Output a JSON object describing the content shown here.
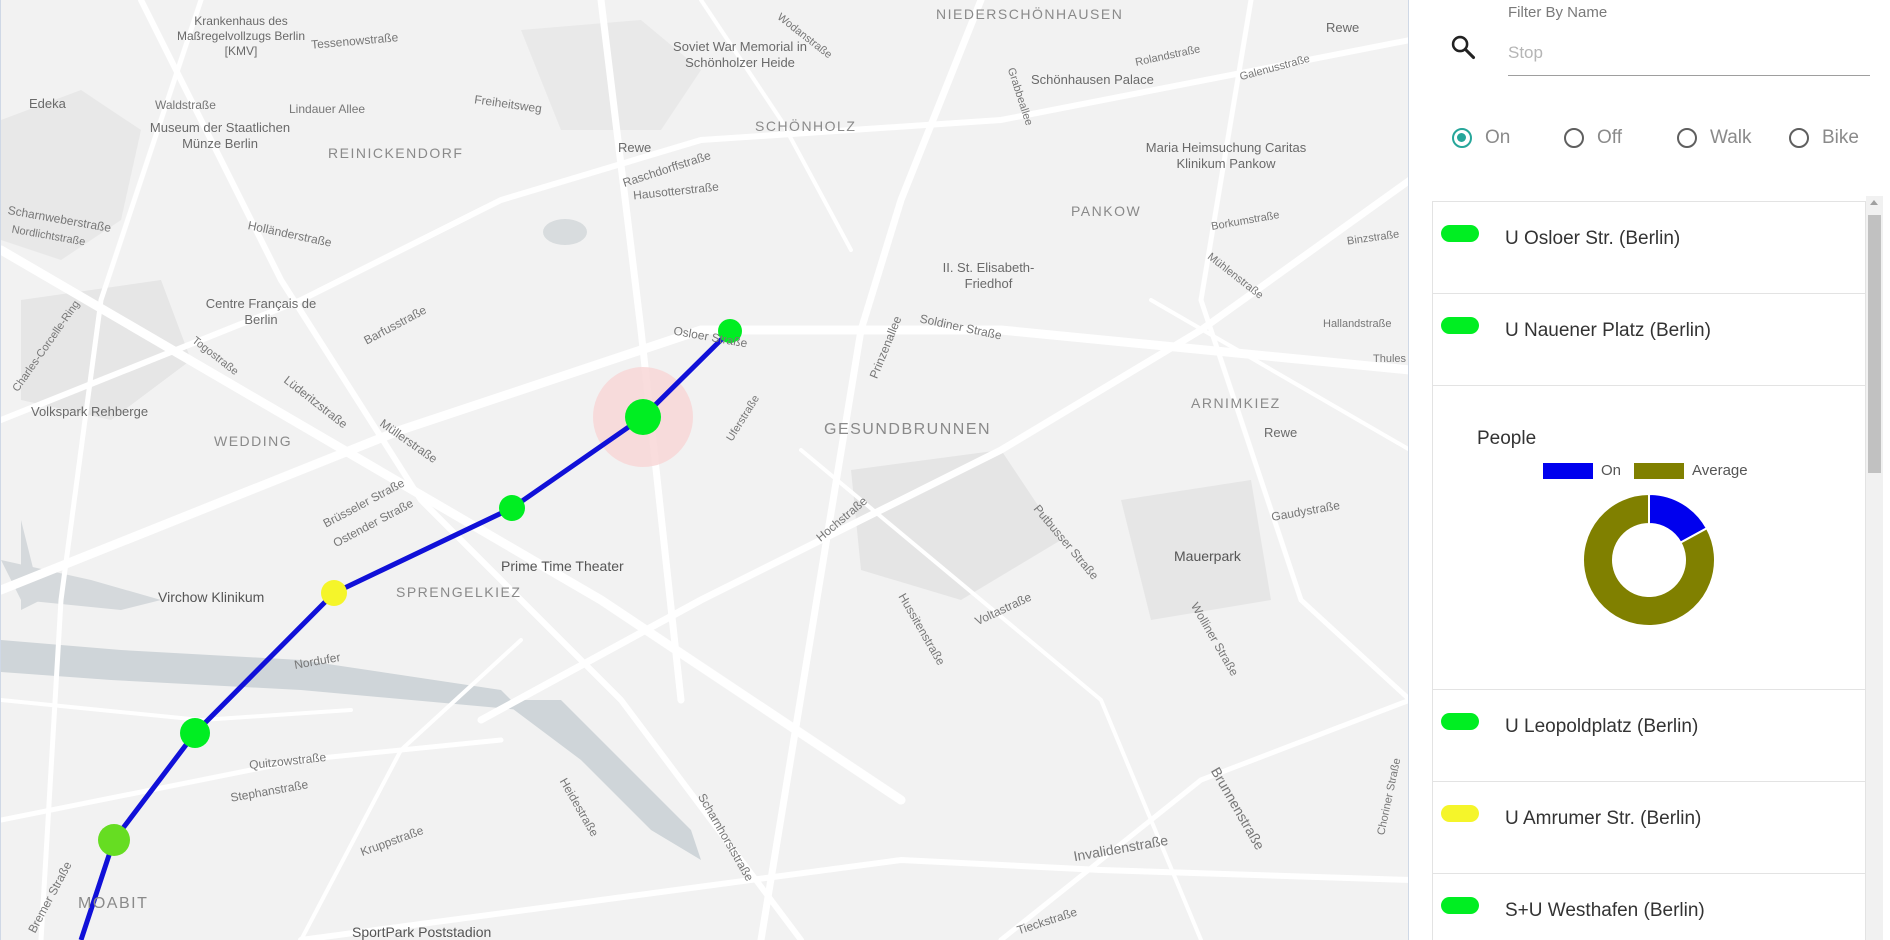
{
  "map": {
    "districts": [
      "NIEDERSCHÖNHAUSEN",
      "SCHÖNHOLZ",
      "REINICKENDORF",
      "PANKOW",
      "WEDDING",
      "GESUNDBRUNNEN",
      "ARNIMKIEZ",
      "SPRENGELKIEZ",
      "MOABIT"
    ],
    "streets": [
      "Tessenowstraße",
      "Waldstraße",
      "Lindauer Allee",
      "Freiheitsweg",
      "Scharnweberstraße",
      "Nordlichtstraße",
      "Holländerstraße",
      "Raschdorffstraße",
      "Hausotterstraße",
      "Rolandstraße",
      "Galenusstraße",
      "Borkumstraße",
      "Binzstraße",
      "Mühlenstraße",
      "Hallandstraße",
      "Thules",
      "Barfusstraße",
      "Togostraße",
      "Lüderitzstraße",
      "Müllerstraße",
      "Osloer Straße",
      "Uferstraße",
      "Prinzenallee",
      "Soldiner Straße",
      "Brüsseler Straße",
      "Ostender Straße",
      "Hochstraße",
      "Putbusser Straße",
      "Gaudystraße",
      "Voltastraße",
      "Hussitenstraße",
      "Wolliner Straße",
      "Nordufer",
      "Quitzowstraße",
      "Stephanstraße",
      "Kruppstraße",
      "Heidestraße",
      "Scharnhorststraße",
      "Invalidenstraße",
      "Brunnenstraße",
      "Tieckstraße",
      "Choriner Straße",
      "Wodanstraße",
      "Grabbeallee",
      "Charles-Corcelle-Ring",
      "Bremer Straße"
    ],
    "pois": [
      "Krankenhaus des Maßregelvollzugs Berlin [KMV]",
      "Soviet War Memorial in Schönholzer Heide",
      "Schönhausen Palace",
      "Maria Heimsuchung Caritas Klinikum Pankow",
      "Edeka",
      "Museum der Staatlichen Münze Berlin",
      "Rewe",
      "Rewe",
      "Rewe",
      "II. St. Elisabeth-Friedhof",
      "Centre Français de Berlin",
      "Volkspark Rehberge",
      "Mauerpark",
      "Prime Time Theater",
      "Virchow Klinikum",
      "SportPark Poststadion"
    ]
  },
  "filter": {
    "label": "Filter By Name",
    "placeholder": "Stop",
    "value": ""
  },
  "modes": [
    {
      "label": "On",
      "checked": true
    },
    {
      "label": "Off",
      "checked": false
    },
    {
      "label": "Walk",
      "checked": false
    },
    {
      "label": "Bike",
      "checked": false
    }
  ],
  "colors": {
    "route": "#1010d8",
    "stop_green": "#00ee22",
    "stop_lightgreen": "#66dd22",
    "stop_yellow": "#f5f52a",
    "chart_on": "#0000ee",
    "chart_average": "#808000",
    "radio_accent": "#26a69a"
  },
  "stops_before": [
    {
      "name": "U Osloer Str. (Berlin)",
      "color": "#00ee22"
    },
    {
      "name": "U Nauener Platz (Berlin)",
      "color": "#00ee22"
    }
  ],
  "chart_card": {
    "title": "People",
    "legend": [
      "On",
      "Average"
    ]
  },
  "chart_data": {
    "type": "pie",
    "title": "People",
    "labels": [
      "On",
      "Average"
    ],
    "values": [
      17,
      83
    ],
    "donut": true,
    "legend": "top"
  },
  "stops_after": [
    {
      "name": "U Leopoldplatz (Berlin)",
      "color": "#00ee22"
    },
    {
      "name": "U Amrumer Str. (Berlin)",
      "color": "#f5f52a"
    },
    {
      "name": "S+U Westhafen (Berlin)",
      "color": "#00ee22"
    }
  ]
}
